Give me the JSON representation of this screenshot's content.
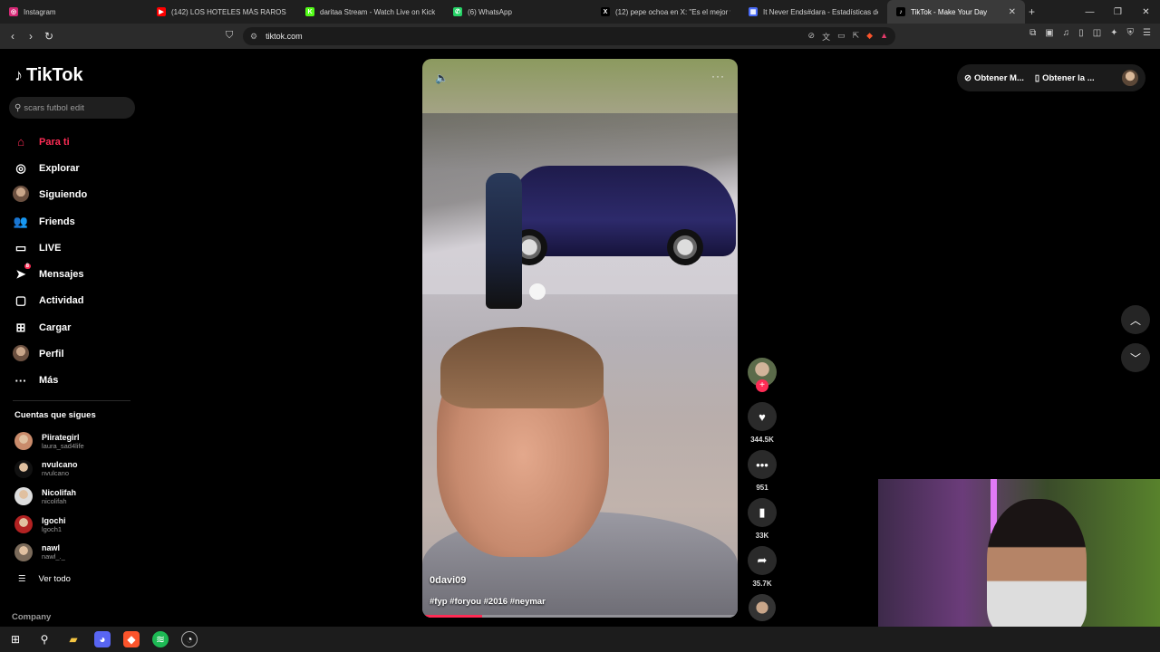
{
  "browser": {
    "tabs": [
      {
        "label": "Instagram",
        "color": "#d62976",
        "glyph": "◎"
      },
      {
        "label": "(142) LOS HOTELES MÁS RAROS DE",
        "color": "#ff0000",
        "glyph": "▶"
      },
      {
        "label": "daritaa Stream - Watch Live on Kick",
        "color": "#53fc18",
        "glyph": "K"
      },
      {
        "label": "(6) WhatsApp",
        "color": "#25d366",
        "glyph": "✆"
      },
      {
        "label": "(12) pepe ochoa en X: \"Es el mejor v",
        "color": "#000000",
        "glyph": "X"
      },
      {
        "label": "It Never Ends#dara - Estadísticas de",
        "color": "#4a6cf7",
        "glyph": "▦"
      },
      {
        "label": "TikTok - Make Your Day",
        "color": "#000000",
        "glyph": "♪"
      }
    ],
    "url": "tiktok.com"
  },
  "sidebar": {
    "logo": "TikTok",
    "search_placeholder": "scars futbol edit",
    "menu": [
      {
        "label": "Para ti",
        "icon": "home-icon",
        "glyph": "⌂"
      },
      {
        "label": "Explorar",
        "icon": "compass-icon",
        "glyph": "◎"
      },
      {
        "label": "Siguiendo",
        "icon": "avatar-icon",
        "glyph": ""
      },
      {
        "label": "Friends",
        "icon": "friends-icon",
        "glyph": "👥"
      },
      {
        "label": "LIVE",
        "icon": "live-icon",
        "glyph": "▭"
      },
      {
        "label": "Mensajes",
        "icon": "send-icon",
        "glyph": "➤",
        "badge": "8"
      },
      {
        "label": "Actividad",
        "icon": "activity-icon",
        "glyph": "▢"
      },
      {
        "label": "Cargar",
        "icon": "upload-icon",
        "glyph": "⊞"
      },
      {
        "label": "Perfil",
        "icon": "profile-icon",
        "glyph": ""
      },
      {
        "label": "Más",
        "icon": "more-icon",
        "glyph": "···"
      }
    ],
    "following_title": "Cuentas que sigues",
    "following": [
      {
        "name": "Piirategirl",
        "user": "laura_sad4life",
        "color": "#c98b6b"
      },
      {
        "name": "nvulcano",
        "user": "nvulcano",
        "color": "#111111"
      },
      {
        "name": "Nicolifah",
        "user": "nicolifah",
        "color": "#dddddd"
      },
      {
        "name": "lgochi",
        "user": "lgoch1",
        "color": "#b22222"
      },
      {
        "name": "nawl",
        "user": "nawl_._",
        "color": "#7a6a5a"
      }
    ],
    "see_all": "Ver todo",
    "company": "Company"
  },
  "video": {
    "username": "0davi09",
    "tags": "#fyp #foryou #2016 #neymar",
    "progress": 0.19
  },
  "actions": {
    "likes": "344.5K",
    "comments": "951",
    "saves": "33K",
    "shares": "35.7K"
  },
  "top_right": {
    "item1": "Obtener M...",
    "item2": "Obtener la ..."
  }
}
